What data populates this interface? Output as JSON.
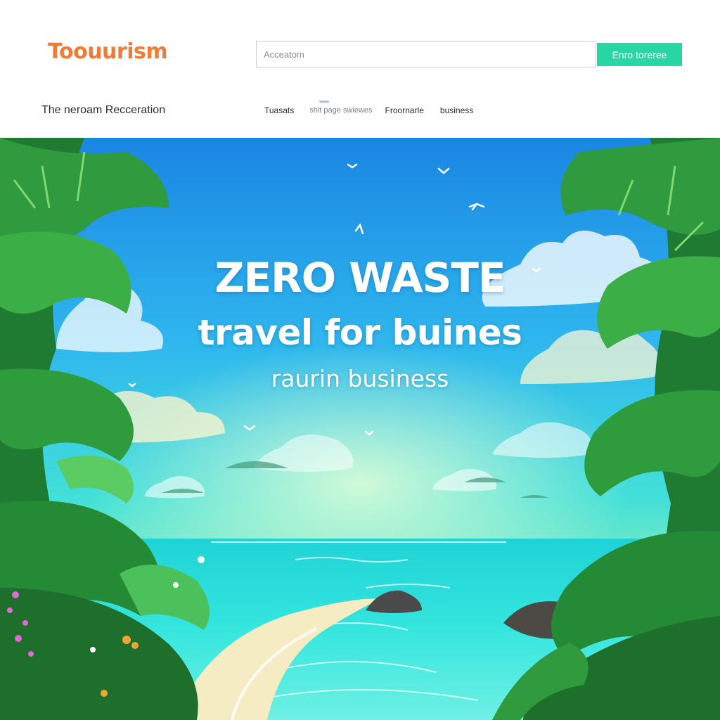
{
  "header": {
    "logo_text": "Toouurism",
    "search_placeholder": "Acceatom",
    "cta_label": "Enro toreree",
    "site_subtitle": "The neroam Recceration",
    "nav": [
      "Tuasats",
      "shlt page swiewes",
      "Froornarle",
      "business"
    ]
  },
  "hero": {
    "headline_1": "ZERO WASTE",
    "headline_2": "travel for buines",
    "subheadline": "raurin business",
    "image": "tropical-beach-illustration"
  },
  "colors": {
    "logo": "#f07a36",
    "cta": "#27d6a3",
    "sky_top": "#1f8fe6",
    "sea": "#2ee6d8",
    "foliage": "#2f9a3e"
  }
}
